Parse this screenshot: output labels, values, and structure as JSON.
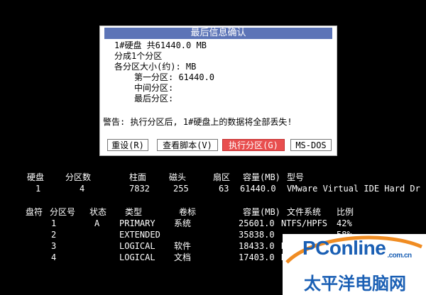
{
  "dialog": {
    "title": "最后信息确认",
    "disk_line": "1#硬盘 共61440.0 MB",
    "partition_count": "分成1个分区",
    "size_label": "各分区大小(约): MB",
    "first_partition": "第一分区: 61440.0",
    "middle_partition": "中间分区:",
    "last_partition": "最后分区:",
    "warning": "警告: 执行分区后, 1#硬盘上的数据将全部丢失!",
    "buttons": {
      "reset": "重设(R)",
      "view_script": "查看脚本(V)",
      "execute": "执行分区(G)",
      "msdos": "MS-DOS"
    }
  },
  "disk_table": {
    "headers": [
      "硬盘",
      "分区数",
      "柱面",
      "磁头",
      "扇区",
      "容量(MB)",
      "型号"
    ],
    "row": [
      "1",
      "4",
      "7832",
      "255",
      "63",
      "61440.0",
      "VMware Virtual IDE Hard Dr"
    ]
  },
  "partition_table": {
    "headers": [
      "盘符",
      "分区号",
      "状态",
      "类型",
      "卷标",
      "容量(MB)",
      "文件系统",
      "比例"
    ],
    "rows": [
      {
        "num": "1",
        "status": "A",
        "type": "PRIMARY",
        "label": "系统",
        "size": "25601.0",
        "fs": "NTFS/HPFS",
        "pct": "42%"
      },
      {
        "num": "2",
        "status": "",
        "type": "EXTENDED",
        "label": "",
        "size": "35838.0",
        "fs": "",
        "pct": "58%"
      },
      {
        "num": "3",
        "status": "",
        "type": "LOGICAL",
        "label": "软件",
        "size": "18433.0",
        "fs": "N",
        "pct": ""
      },
      {
        "num": "4",
        "status": "",
        "type": "LOGICAL",
        "label": "文档",
        "size": "17403.0",
        "fs": "N",
        "pct": ""
      }
    ]
  },
  "logo": {
    "brand": "PConline",
    "tld": ".com.cn",
    "cn": "太平洋电脑网"
  },
  "colors": {
    "title_bar": "#5c74b7",
    "execute_button": "#e84e4e",
    "logo_blue": "#1a5fb4",
    "logo_orange": "#f08c22"
  }
}
